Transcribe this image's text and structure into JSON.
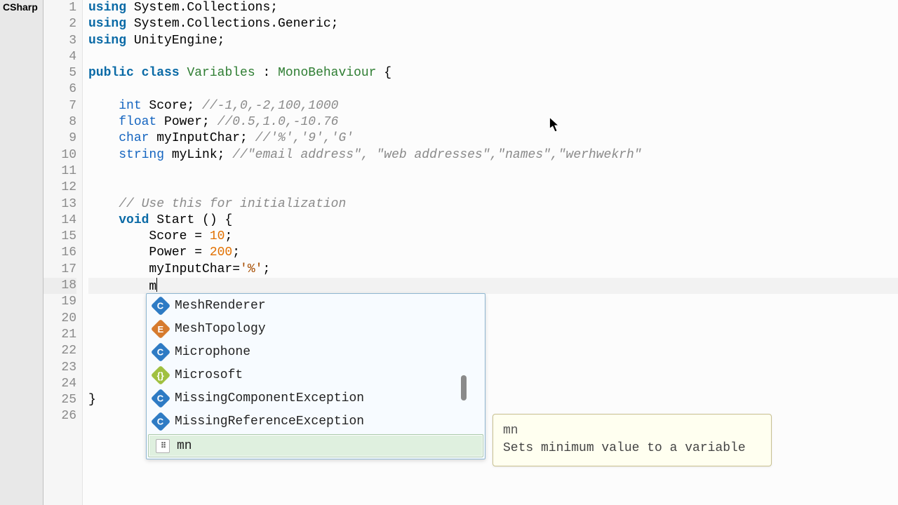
{
  "sidebar": {
    "tab": "CSharp"
  },
  "lines": [
    {
      "n": 1,
      "tokens": [
        [
          "kw",
          "using"
        ],
        [
          "",
          " System.Collections;"
        ]
      ]
    },
    {
      "n": 2,
      "tokens": [
        [
          "kw",
          "using"
        ],
        [
          "",
          " System.Collections.Generic;"
        ]
      ]
    },
    {
      "n": 3,
      "tokens": [
        [
          "kw",
          "using"
        ],
        [
          "",
          " UnityEngine;"
        ]
      ]
    },
    {
      "n": 4,
      "tokens": []
    },
    {
      "n": 5,
      "tokens": [
        [
          "kw",
          "public class "
        ],
        [
          "cls",
          "Variables"
        ],
        [
          "",
          " : "
        ],
        [
          "cls",
          "MonoBehaviour"
        ],
        [
          "",
          " {"
        ]
      ]
    },
    {
      "n": 6,
      "tokens": []
    },
    {
      "n": 7,
      "tokens": [
        [
          "",
          "    "
        ],
        [
          "typ",
          "int"
        ],
        [
          "",
          " Score; "
        ],
        [
          "com",
          "//-1,0,-2,100,1000"
        ]
      ]
    },
    {
      "n": 8,
      "tokens": [
        [
          "",
          "    "
        ],
        [
          "typ",
          "float"
        ],
        [
          "",
          " Power; "
        ],
        [
          "com",
          "//0.5,1.0,-10.76"
        ]
      ]
    },
    {
      "n": 9,
      "tokens": [
        [
          "",
          "    "
        ],
        [
          "typ",
          "char"
        ],
        [
          "",
          " myInputChar; "
        ],
        [
          "com",
          "//'%','9','G'"
        ]
      ]
    },
    {
      "n": 10,
      "tokens": [
        [
          "",
          "    "
        ],
        [
          "typ",
          "string"
        ],
        [
          "",
          " myLink; "
        ],
        [
          "com",
          "//\"email address\", \"web addresses\",\"names\",\"werhwekrh\""
        ]
      ]
    },
    {
      "n": 11,
      "tokens": []
    },
    {
      "n": 12,
      "tokens": []
    },
    {
      "n": 13,
      "tokens": [
        [
          "",
          "    "
        ],
        [
          "com",
          "// Use this for initialization"
        ]
      ]
    },
    {
      "n": 14,
      "tokens": [
        [
          "",
          "    "
        ],
        [
          "kw",
          "void"
        ],
        [
          "",
          " Start () {"
        ]
      ]
    },
    {
      "n": 15,
      "tokens": [
        [
          "",
          "        Score = "
        ],
        [
          "num",
          "10"
        ],
        [
          "",
          ";"
        ]
      ]
    },
    {
      "n": 16,
      "tokens": [
        [
          "",
          "        Power = "
        ],
        [
          "num",
          "200"
        ],
        [
          "",
          ";"
        ]
      ]
    },
    {
      "n": 17,
      "tokens": [
        [
          "",
          "        myInputChar="
        ],
        [
          "chr",
          "'%'"
        ],
        [
          "",
          ";"
        ]
      ]
    },
    {
      "n": 18,
      "tokens": [
        [
          "",
          "        m"
        ]
      ],
      "current": true,
      "caret": true
    },
    {
      "n": 19,
      "tokens": []
    },
    {
      "n": 20,
      "tokens": []
    },
    {
      "n": 21,
      "tokens": []
    },
    {
      "n": 22,
      "tokens": []
    },
    {
      "n": 23,
      "tokens": []
    },
    {
      "n": 24,
      "tokens": []
    },
    {
      "n": 25,
      "tokens": [
        [
          "",
          "}"
        ]
      ]
    },
    {
      "n": 26,
      "tokens": []
    }
  ],
  "autocomplete": {
    "items": [
      {
        "icon": "C",
        "iconClass": "ic-c",
        "label": "MeshRenderer"
      },
      {
        "icon": "E",
        "iconClass": "ic-e",
        "label": "MeshTopology"
      },
      {
        "icon": "C",
        "iconClass": "ic-c",
        "label": "Microphone"
      },
      {
        "icon": "{}",
        "iconClass": "ic-n",
        "label": "Microsoft"
      },
      {
        "icon": "C",
        "iconClass": "ic-c",
        "label": "MissingComponentException"
      },
      {
        "icon": "C",
        "iconClass": "ic-c",
        "label": "MissingReferenceException"
      },
      {
        "icon": "⠿",
        "iconClass": "ic-s",
        "label": "mn",
        "selected": true
      }
    ]
  },
  "tooltip": {
    "title": "mn",
    "body": "Sets minimum value to a variable"
  }
}
